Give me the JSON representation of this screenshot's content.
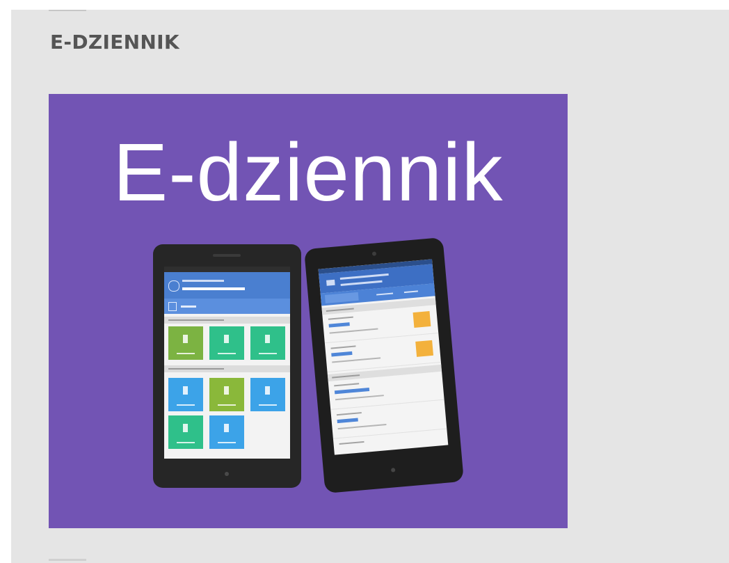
{
  "widget": {
    "heading": "E-DZIENNIK",
    "banner": {
      "title": "E-dziennik",
      "background_color": "#7254b4",
      "image_description_icons": [
        "tablet-left-icon",
        "tablet-right-icon"
      ]
    }
  }
}
